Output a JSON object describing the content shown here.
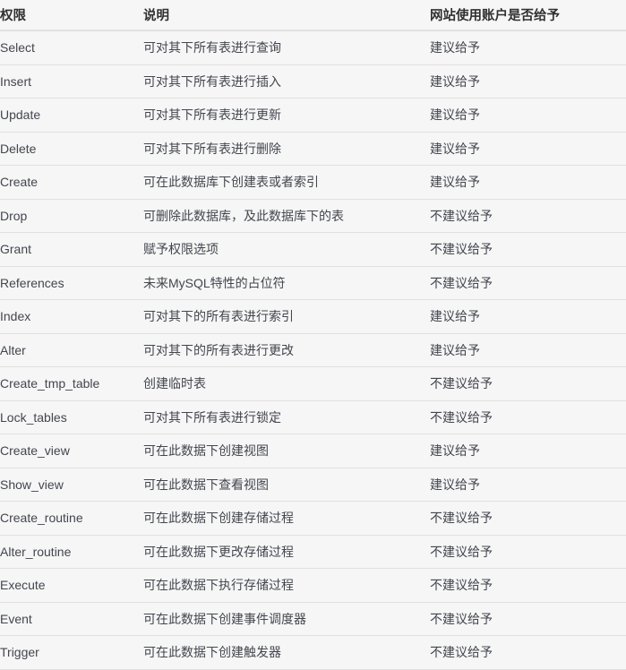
{
  "table": {
    "columns": [
      {
        "key": "privilege",
        "label": "权限"
      },
      {
        "key": "description",
        "label": "说明"
      },
      {
        "key": "grant",
        "label": "网站使用账户是否给予"
      }
    ],
    "rows": [
      {
        "privilege": "Select",
        "description": "可对其下所有表进行查询",
        "grant": "建议给予"
      },
      {
        "privilege": "Insert",
        "description": "可对其下所有表进行插入",
        "grant": "建议给予"
      },
      {
        "privilege": "Update",
        "description": "可对其下所有表进行更新",
        "grant": "建议给予"
      },
      {
        "privilege": "Delete",
        "description": "可对其下所有表进行删除",
        "grant": "建议给予"
      },
      {
        "privilege": "Create",
        "description": "可在此数据库下创建表或者索引",
        "grant": "建议给予"
      },
      {
        "privilege": "Drop",
        "description": "可删除此数据库，及此数据库下的表",
        "grant": "不建议给予"
      },
      {
        "privilege": "Grant",
        "description": "赋予权限选项",
        "grant": "不建议给予"
      },
      {
        "privilege": "References",
        "description": "未来MySQL特性的占位符",
        "grant": "不建议给予"
      },
      {
        "privilege": "Index",
        "description": "可对其下的所有表进行索引",
        "grant": "建议给予"
      },
      {
        "privilege": "Alter",
        "description": "可对其下的所有表进行更改",
        "grant": "建议给予"
      },
      {
        "privilege": "Create_tmp_table",
        "description": "创建临时表",
        "grant": "不建议给予"
      },
      {
        "privilege": "Lock_tables",
        "description": "可对其下所有表进行锁定",
        "grant": "不建议给予"
      },
      {
        "privilege": "Create_view",
        "description": "可在此数据下创建视图",
        "grant": "建议给予"
      },
      {
        "privilege": "Show_view",
        "description": "可在此数据下查看视图",
        "grant": "建议给予"
      },
      {
        "privilege": "Create_routine",
        "description": "可在此数据下创建存储过程",
        "grant": "不建议给予"
      },
      {
        "privilege": "Alter_routine",
        "description": "可在此数据下更改存储过程",
        "grant": "不建议给予"
      },
      {
        "privilege": "Execute",
        "description": "可在此数据下执行存储过程",
        "grant": "不建议给予"
      },
      {
        "privilege": "Event",
        "description": "可在此数据下创建事件调度器",
        "grant": "不建议给予"
      },
      {
        "privilege": "Trigger",
        "description": "可在此数据下创建触发器",
        "grant": "不建议给予"
      }
    ]
  },
  "colors": {
    "page_background": "#f6f6f6",
    "header_text": "#303030",
    "body_text": "#43464e",
    "row_separator": "#e0e0e0",
    "header_separator": "#e2e2e2"
  }
}
